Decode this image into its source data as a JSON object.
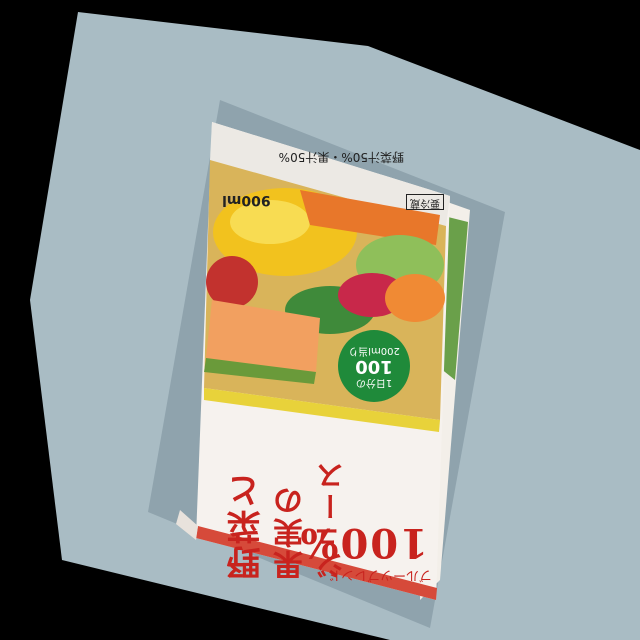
{
  "photo": {
    "background": "#000000",
    "surface_color": "#a9bcc4"
  },
  "carton": {
    "title_line1": "野菜と",
    "title_line2": "果実の",
    "title_line3": "ジュース",
    "percent": "100%",
    "subtitle": "ブルーツブレンド",
    "badge_line1": "1日分の",
    "badge_big": "100",
    "badge_line2": "200ml当り",
    "volume": "900ml",
    "ingredients": "野菜汁50%・果汁50%",
    "storage": "要冷蔵"
  }
}
